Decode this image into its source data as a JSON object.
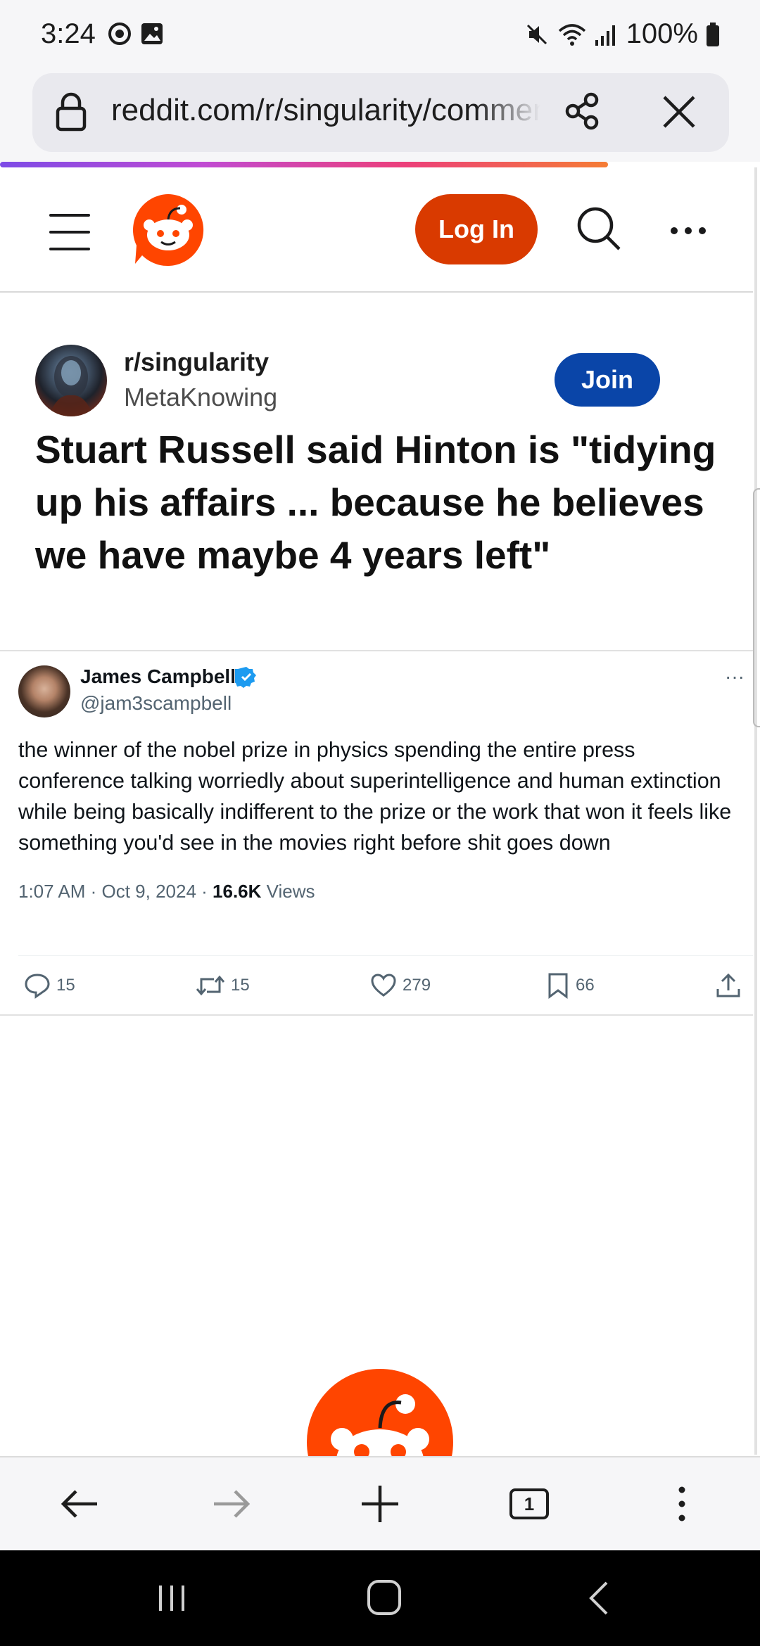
{
  "status_bar": {
    "time": "3:24",
    "battery": "100%",
    "icons": [
      "vpn-icon",
      "gallery-icon",
      "mute-icon",
      "wifi-icon",
      "signal-icon",
      "battery-icon"
    ]
  },
  "browser": {
    "url": "reddit.com/r/singularity/comments",
    "icons": [
      "lock-icon",
      "share-icon",
      "close-icon"
    ],
    "progress_fraction": 0.8
  },
  "reddit_header": {
    "login_label": "Log In",
    "icons": [
      "menu-icon",
      "reddit-logo",
      "search-icon",
      "more-icon"
    ]
  },
  "post": {
    "subreddit": "r/singularity",
    "author": "MetaKnowing",
    "join_label": "Join",
    "title": "Stuart Russell said Hinton is \"tidying up his affairs ... because he believes we have maybe 4 years left\""
  },
  "tweet": {
    "name": "James Campbell",
    "handle": "@jam3scampbell",
    "more": "···",
    "text": "the winner of the nobel prize in physics spending the entire press conference talking worriedly about superintelligence and human extinction while being basically indifferent to the prize or the work that won it feels like something you'd see in the movies right before shit goes down",
    "date": "1:07 AM · Oct 9, 2024 · ",
    "views_count": "16.6K",
    "views_label": " Views",
    "replies": "15",
    "retweets": "15",
    "likes": "279",
    "bookmarks": "66"
  },
  "toolbar": {
    "tabs_count": "1",
    "icons": [
      "back-icon",
      "forward-icon",
      "new-tab-icon",
      "tabs-icon",
      "menu-icon"
    ]
  },
  "colors": {
    "reddit_orange": "#d93a00",
    "join_blue": "#0a45a8",
    "verified_blue": "#1d9bf0"
  }
}
